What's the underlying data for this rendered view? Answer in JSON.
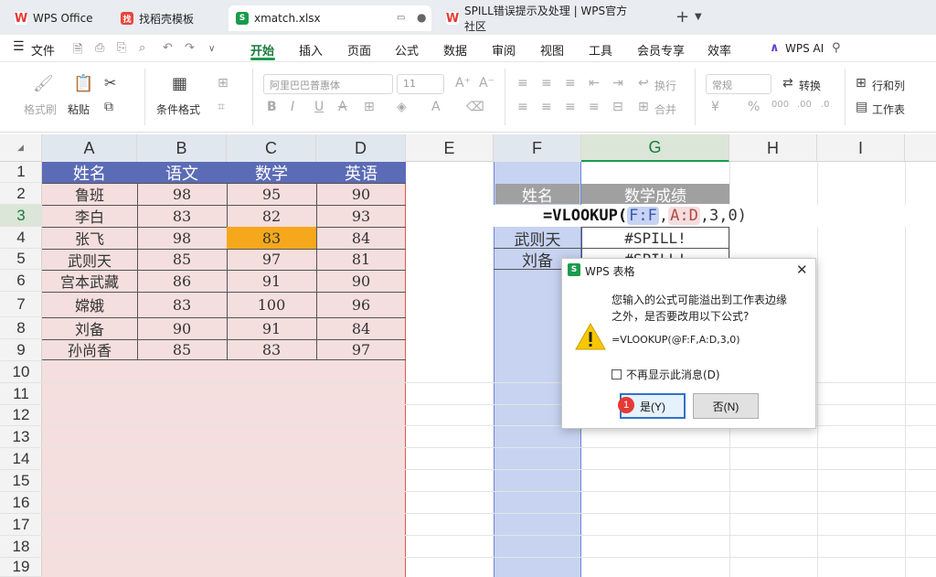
{
  "tabs": [
    {
      "label": "WPS Office",
      "icon": "wps-logo-icon"
    },
    {
      "label": "找稻壳模板",
      "icon": "docer-icon"
    },
    {
      "label": "xmatch.xlsx",
      "icon": "spreadsheet-icon",
      "active": true
    },
    {
      "label": "SPILL错误提示及处理 | WPS官方社区",
      "icon": "wps-logo-icon"
    }
  ],
  "menu": {
    "file": "文件",
    "items": [
      "开始",
      "插入",
      "页面",
      "公式",
      "数据",
      "审阅",
      "视图",
      "工具",
      "会员专享",
      "效率"
    ],
    "active": "开始",
    "ai": "WPS AI"
  },
  "ribbon": {
    "format_painter": "格式刷",
    "paste": "粘贴",
    "conditional_format": "条件格式",
    "font_name": "阿里巴巴普惠体",
    "font_size": "11",
    "wrap": "换行",
    "merge": "合并",
    "number_format": "常规",
    "convert": "转换",
    "rows_cols": "行和列",
    "worksheet": "工作表",
    "bold": "B",
    "italic": "I",
    "underline": "U",
    "strike": "A",
    "currency": "¥",
    "percent": "%"
  },
  "sheet": {
    "columns": [
      "A",
      "B",
      "C",
      "D",
      "E",
      "F",
      "G",
      "H",
      "I"
    ],
    "rows": [
      "1",
      "2",
      "3",
      "4",
      "5",
      "6",
      "7",
      "8",
      "9",
      "10",
      "11",
      "12",
      "13",
      "14",
      "15",
      "16",
      "17",
      "18",
      "19"
    ],
    "table_header": [
      "姓名",
      "语文",
      "数学",
      "英语"
    ],
    "table_rows": [
      [
        "鲁班",
        "98",
        "95",
        "90"
      ],
      [
        "李白",
        "83",
        "82",
        "93"
      ],
      [
        "张飞",
        "98",
        "83",
        "84"
      ],
      [
        "武则天",
        "85",
        "97",
        "81"
      ],
      [
        "宫本武藏",
        "86",
        "91",
        "90"
      ],
      [
        "嫦娥",
        "83",
        "100",
        "96"
      ],
      [
        "刘备",
        "90",
        "91",
        "84"
      ],
      [
        "孙尚香",
        "85",
        "83",
        "97"
      ]
    ],
    "lookup_header": [
      "姓名",
      "数学成绩"
    ],
    "formula_prefix": "=VLOOKUP(",
    "formula_ref1": "F:F",
    "formula_sep": ",",
    "formula_ref2": "A:D",
    "formula_suffix": ",3,0)",
    "lookup_names": [
      "武则天",
      "刘备"
    ],
    "lookup_results": [
      "#SPILL!",
      "#SPILL!"
    ],
    "colors": {
      "table_header_bg": "#5b6bb5",
      "table_body_bg": "#f4dede",
      "highlight_cell": "#f5a81c",
      "column_f_bg": "#c7d3f1",
      "lookup_header_bg": "#a0a0a0"
    }
  },
  "dialog": {
    "title": "WPS 表格",
    "message": "您输入的公式可能溢出到工作表边缘之外，是否要改用以下公式?",
    "formula": "=VLOOKUP(@F:F,A:D,3,0)",
    "checkbox": "不再显示此消息(D)",
    "yes": "是(Y)",
    "no": "否(N)",
    "badge": "1"
  }
}
